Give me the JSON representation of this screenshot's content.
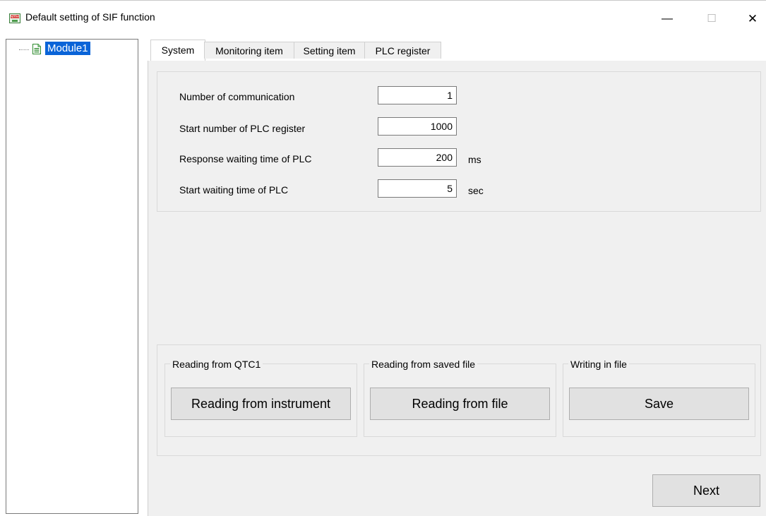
{
  "window": {
    "title": "Default setting of SIF function",
    "icon_text": "QTC1",
    "minimize": "—",
    "maximize": "☐",
    "close": "✕"
  },
  "tree": {
    "items": [
      {
        "label": "Module1",
        "icon": "document-icon",
        "selected": true
      }
    ]
  },
  "tabs": [
    {
      "label": "System",
      "active": true
    },
    {
      "label": "Monitoring item",
      "active": false
    },
    {
      "label": "Setting item",
      "active": false
    },
    {
      "label": "PLC register",
      "active": false
    }
  ],
  "settings": {
    "rows": [
      {
        "label": "Number of communication",
        "value": "1",
        "unit": ""
      },
      {
        "label": "Start number of PLC register",
        "value": "1000",
        "unit": ""
      },
      {
        "label": "Response waiting time of PLC",
        "value": "200",
        "unit": "ms"
      },
      {
        "label": "Start waiting time of PLC",
        "value": "5",
        "unit": "sec"
      }
    ]
  },
  "groups": [
    {
      "legend": "Reading from QTC1",
      "button": "Reading from instrument"
    },
    {
      "legend": "Reading from saved file",
      "button": "Reading from file"
    },
    {
      "legend": "Writing in file",
      "button": "Save"
    }
  ],
  "footer": {
    "next": "Next"
  },
  "colors": {
    "selection": "#0a64d8",
    "panel_bg": "#f0f0f0",
    "button_bg": "#e1e1e1"
  }
}
